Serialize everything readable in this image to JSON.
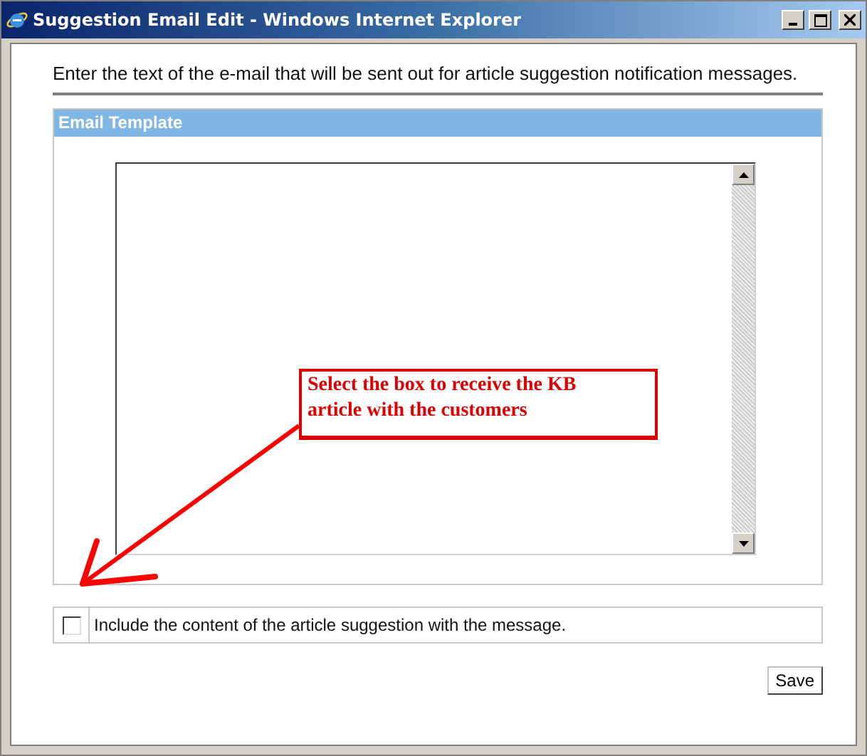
{
  "window": {
    "title": "Suggestion Email Edit - Windows Internet Explorer"
  },
  "intro": "Enter the text of the e-mail that will be sent out for article suggestion notification messages.",
  "panel": {
    "title": "Email Template"
  },
  "include_option": {
    "label": "Include the content of the article suggestion with the message.",
    "checked": false
  },
  "buttons": [
    "Save"
  ],
  "annotation": {
    "text": "Select the box to receive the KB article with the customers"
  }
}
